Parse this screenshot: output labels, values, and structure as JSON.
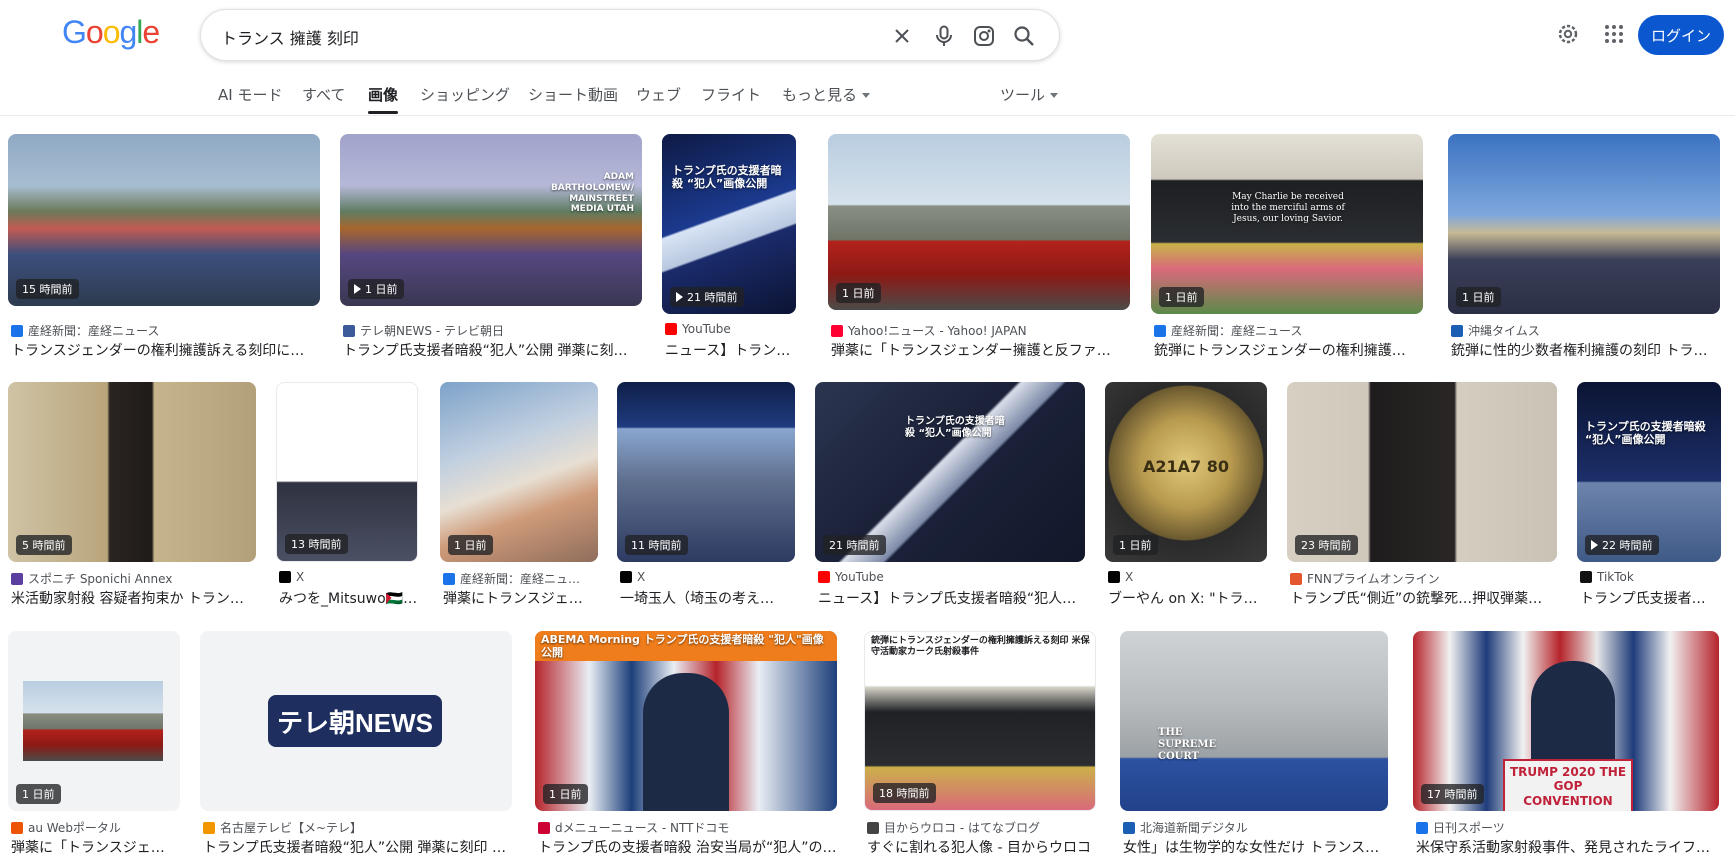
{
  "header": {
    "logo_letters": [
      "G",
      "o",
      "o",
      "g",
      "l",
      "e"
    ],
    "logo_colors": [
      "#4285f4",
      "#ea4335",
      "#fbbc05",
      "#4285f4",
      "#34a853",
      "#ea4335"
    ],
    "query": "トランス 擁護 刻印",
    "login_label": "ログイン",
    "icons": [
      "clear-icon",
      "mic-icon",
      "lens-icon",
      "search-icon",
      "settings-icon",
      "apps-icon"
    ]
  },
  "tabs": [
    {
      "label": "AI モード",
      "active": false
    },
    {
      "label": "すべて",
      "active": false
    },
    {
      "label": "画像",
      "active": true
    },
    {
      "label": "ショッピング",
      "active": false
    },
    {
      "label": "ショート動画",
      "active": false
    },
    {
      "label": "ウェブ",
      "active": false
    },
    {
      "label": "フライト",
      "active": false
    },
    {
      "label": "もっと見る",
      "active": false
    },
    {
      "label": "ツール",
      "active": false
    }
  ],
  "results": [
    {
      "badge": "15 時間前",
      "video": false,
      "source": "産経新聞：産経ニュース",
      "title": "トランスジェンダーの権利擁護訴える刻印に…",
      "fav": "#1a73e8"
    },
    {
      "badge": "1 日前",
      "video": true,
      "source": "テレ朝NEWS - テレビ朝日",
      "title": "トランプ氏支援者暗殺“犯人”公開 弾薬に刻…",
      "fav": "#3c5a99",
      "overlay": "ADAM BARTHOLOMEW/ MAINSTREET MEDIA UTAH"
    },
    {
      "badge": "21 時間前",
      "video": true,
      "source": "YouTube",
      "title": "ニュース】トラン…",
      "fav": "#ff0000",
      "overlay": "トランプ氏の支援者暗殺 “犯人”画像公開"
    },
    {
      "badge": "1 日前",
      "video": false,
      "source": "Yahoo!ニュース - Yahoo! JAPAN",
      "title": "弾薬に「トランスジェンダー擁護と反ファ…",
      "fav": "#ff0033"
    },
    {
      "badge": "1 日前",
      "video": false,
      "source": "産経新聞：産経ニュース",
      "title": "銃弾にトランスジェンダーの権利擁護…",
      "fav": "#1a73e8",
      "overlay": "May Charlie be received into the merciful arms of Jesus, our loving Savior."
    },
    {
      "badge": "1 日前",
      "video": false,
      "source": "沖縄タイムス",
      "title": "銃弾に性的少数者権利擁護の刻印 トラ…",
      "fav": "#1a5fb4"
    },
    {
      "badge": "5 時間前",
      "video": false,
      "source": "スポニチ Sponichi Annex",
      "title": "米活動家射殺 容疑者拘束か トラン…",
      "fav": "#5b3fa0"
    },
    {
      "badge": "13 時間前",
      "video": false,
      "source": "X",
      "title": "みつを_Mitsuwo🇵🇸…",
      "fav": "#000000"
    },
    {
      "badge": "1 日前",
      "video": false,
      "source": "産経新聞：産経ニュ…",
      "title": "弾薬にトランスジェ…",
      "fav": "#1a73e8"
    },
    {
      "badge": "11 時間前",
      "video": false,
      "source": "X",
      "title": "一埼玉人（埼玉の考え…",
      "fav": "#000000"
    },
    {
      "badge": "21 時間前",
      "video": false,
      "source": "YouTube",
      "title": "ニュース】トランプ氏支援者暗殺“犯人…",
      "fav": "#ff0000",
      "overlay": "トランプ氏の支援者暗殺 “犯人”画像公開"
    },
    {
      "badge": "1 日前",
      "video": false,
      "source": "X",
      "title": "ブーやん on X: \"トラ…",
      "fav": "#000000",
      "overlay": "A21A7 80"
    },
    {
      "badge": "23 時間前",
      "video": false,
      "source": "FNNプライムオンライン",
      "title": "トランプ氏“側近”の銃撃死…押収弾薬…",
      "fav": "#e4572e"
    },
    {
      "badge": "22 時間前",
      "video": true,
      "source": "TikTok",
      "title": "トランプ氏支援者…",
      "fav": "#111111",
      "overlay": "トランプ氏の支援者暗殺 “犯人”画像公開"
    },
    {
      "badge": "1 日前",
      "video": false,
      "source": "au Webポータル",
      "title": "弾薬に「トランスジェ…",
      "fav": "#eb5505"
    },
    {
      "badge": "",
      "video": false,
      "source": "名古屋テレビ【メ~テレ】",
      "title": "トランプ氏支援者暗殺“犯人”公開 弾薬に刻印 …",
      "fav": "#f29600",
      "overlay": "テレ朝NEWS"
    },
    {
      "badge": "1 日前",
      "video": false,
      "source": "dメニューニュース - NTTドコモ",
      "title": "トランプ氏の支援者暗殺 治安当局が“犯人”の…",
      "fav": "#cc0033",
      "overlay": "ABEMA Morning トランプ氏の支援者暗殺 \"犯人\"画像公開"
    },
    {
      "badge": "18 時間前",
      "video": false,
      "source": "目からウロコ - はてなブログ",
      "title": "すぐに割れる犯人像 - 目からウロコ",
      "fav": "#444444",
      "overlay": "銃弾にトランスジェンダーの権利擁護訴える刻印 米保守活動家カーク氏射殺事件"
    },
    {
      "badge": "",
      "video": false,
      "source": "北海道新聞デジタル",
      "title": "女性」は生物学的な女性だけ トランス…",
      "fav": "#1a5fb4",
      "overlay": "THE SUPREME COURT"
    },
    {
      "badge": "17 時間前",
      "video": false,
      "source": "日刊スポーツ",
      "title": "米保守系活動家射殺事件、発見されたライフ…",
      "fav": "#1a73e8",
      "overlay": "TRUMP 2020 THE GOP CONVENTION"
    }
  ]
}
